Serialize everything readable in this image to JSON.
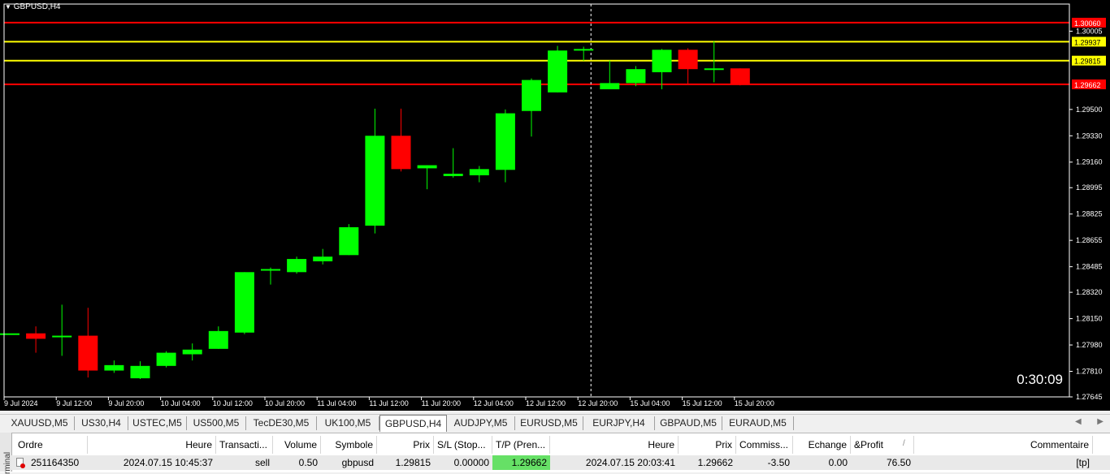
{
  "chart": {
    "title": "GBPUSD,H4",
    "timer": "0:30:09",
    "colors": {
      "bull": "#00ff00",
      "bear": "#ff0000",
      "bg": "#000000",
      "axis": "#ffffff",
      "level_red": "#ff0000",
      "level_yellow": "#ffff00"
    }
  },
  "chart_data": {
    "type": "candlestick",
    "symbol": "GBPUSD",
    "timeframe": "H4",
    "ylim": [
      1.27645,
      1.3018
    ],
    "y_ticks": [
      "1.30005",
      "1.29500",
      "1.29330",
      "1.29160",
      "1.28995",
      "1.28825",
      "1.28655",
      "1.28485",
      "1.28320",
      "1.28150",
      "1.27980",
      "1.27810",
      "1.27645"
    ],
    "x_ticks": [
      "9 Jul 2024",
      "9 Jul 12:00",
      "9 Jul 20:00",
      "10 Jul 04:00",
      "10 Jul 12:00",
      "10 Jul 20:00",
      "11 Jul 04:00",
      "11 Jul 12:00",
      "11 Jul 20:00",
      "12 Jul 04:00",
      "12 Jul 12:00",
      "12 Jul 20:00",
      "15 Jul 04:00",
      "15 Jul 12:00",
      "15 Jul 20:00"
    ],
    "levels": [
      {
        "value": 1.3006,
        "label": "1.30060",
        "color": "#ff0000"
      },
      {
        "value": 1.29937,
        "label": "1.29937",
        "color": "#ffff00"
      },
      {
        "value": 1.29815,
        "label": "1.29815",
        "color": "#ffff00"
      },
      {
        "value": 1.29662,
        "label": "1.29662",
        "color": "#ff0000"
      }
    ],
    "crosshair_index": 22.5,
    "candles": [
      {
        "o": 1.28055,
        "h": 1.28055,
        "l": 1.28055,
        "c": 1.28055
      },
      {
        "o": 1.28055,
        "h": 1.281,
        "l": 1.2793,
        "c": 1.2802
      },
      {
        "o": 1.2803,
        "h": 1.2824,
        "l": 1.2791,
        "c": 1.2804
      },
      {
        "o": 1.2804,
        "h": 1.2822,
        "l": 1.2777,
        "c": 1.27815
      },
      {
        "o": 1.27815,
        "h": 1.2788,
        "l": 1.278,
        "c": 1.2785
      },
      {
        "o": 1.27765,
        "h": 1.27875,
        "l": 1.2776,
        "c": 1.27845
      },
      {
        "o": 1.27845,
        "h": 1.2794,
        "l": 1.27835,
        "c": 1.2793
      },
      {
        "o": 1.2792,
        "h": 1.2799,
        "l": 1.2788,
        "c": 1.2795
      },
      {
        "o": 1.27955,
        "h": 1.281,
        "l": 1.27955,
        "c": 1.2807
      },
      {
        "o": 1.2806,
        "h": 1.2845,
        "l": 1.2805,
        "c": 1.2845
      },
      {
        "o": 1.2846,
        "h": 1.2848,
        "l": 1.2837,
        "c": 1.2847
      },
      {
        "o": 1.2845,
        "h": 1.2855,
        "l": 1.2844,
        "c": 1.28535
      },
      {
        "o": 1.2852,
        "h": 1.286,
        "l": 1.285,
        "c": 1.2855
      },
      {
        "o": 1.2856,
        "h": 1.2876,
        "l": 1.2856,
        "c": 1.2874
      },
      {
        "o": 1.2875,
        "h": 1.29505,
        "l": 1.287,
        "c": 1.2933
      },
      {
        "o": 1.2933,
        "h": 1.29505,
        "l": 1.291,
        "c": 1.29115
      },
      {
        "o": 1.2912,
        "h": 1.2914,
        "l": 1.28985,
        "c": 1.2914
      },
      {
        "o": 1.2907,
        "h": 1.2925,
        "l": 1.2906,
        "c": 1.29085
      },
      {
        "o": 1.29075,
        "h": 1.29135,
        "l": 1.2903,
        "c": 1.29115
      },
      {
        "o": 1.2911,
        "h": 1.295,
        "l": 1.2903,
        "c": 1.29475
      },
      {
        "o": 1.2949,
        "h": 1.297,
        "l": 1.29325,
        "c": 1.2969
      },
      {
        "o": 1.2961,
        "h": 1.2991,
        "l": 1.2961,
        "c": 1.2988
      },
      {
        "o": 1.2988,
        "h": 1.29905,
        "l": 1.29815,
        "c": 1.2989
      },
      {
        "o": 1.2963,
        "h": 1.29815,
        "l": 1.2963,
        "c": 1.2967
      },
      {
        "o": 1.2967,
        "h": 1.2978,
        "l": 1.2965,
        "c": 1.2976
      },
      {
        "o": 1.2974,
        "h": 1.2989,
        "l": 1.2963,
        "c": 1.29885
      },
      {
        "o": 1.29885,
        "h": 1.29895,
        "l": 1.2966,
        "c": 1.2976
      },
      {
        "o": 1.2976,
        "h": 1.2994,
        "l": 1.29675,
        "c": 1.29765
      },
      {
        "o": 1.29765,
        "h": 1.29765,
        "l": 1.29655,
        "c": 1.29665
      }
    ]
  },
  "tabs": {
    "items": [
      "XAUUSD,M5",
      "US30,H4",
      "USTEC,M5",
      "US500,M5",
      "TecDE30,M5",
      "UK100,M5",
      "GBPUSD,H4",
      "AUDJPY,M5",
      "EURUSD,M5",
      "EURJPY,H4",
      "GBPAUD,M5",
      "EURAUD,M5"
    ],
    "active": "GBPUSD,H4"
  },
  "terminal": {
    "side_label": "rminal",
    "headers": [
      "Ordre",
      "Heure",
      "Transacti...",
      "Volume",
      "Symbole",
      "Prix",
      "S/L (Stop...",
      "T/P (Pren...",
      "Heure",
      "Prix",
      "Commiss...",
      "Echange",
      "&Profit",
      "Commentaire"
    ],
    "profit_sort_mark": "/",
    "row": [
      "251164350",
      "2024.07.15 10:45:37",
      "sell",
      "0.50",
      "gbpusd",
      "1.29815",
      "0.00000",
      "1.29662",
      "2024.07.15 20:03:41",
      "1.29662",
      "-3.50",
      "0.00",
      "76.50",
      "[tp]"
    ]
  }
}
